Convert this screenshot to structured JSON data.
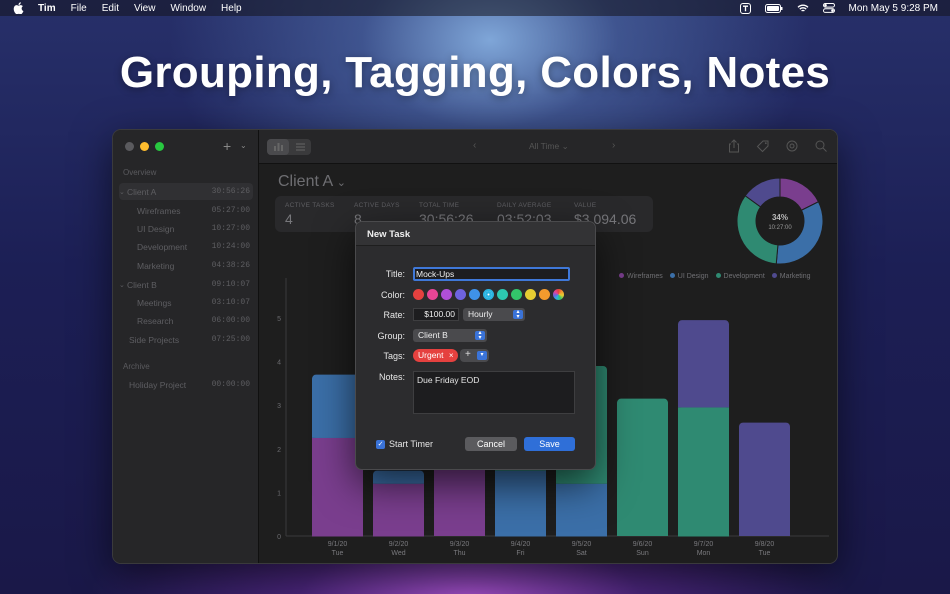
{
  "menubar": {
    "items": [
      "Tim",
      "File",
      "Edit",
      "View",
      "Window",
      "Help"
    ],
    "clock": "Mon May 5  9:28 PM"
  },
  "headline": "Grouping, Tagging, Colors, Notes",
  "sidebar": {
    "overview_label": "Overview",
    "archive_label": "Archive",
    "rows": [
      {
        "label": "Client A",
        "time": "30:56:26"
      },
      {
        "label": "Wireframes",
        "time": "05:27:00"
      },
      {
        "label": "UI Design",
        "time": "10:27:00"
      },
      {
        "label": "Development",
        "time": "10:24:00"
      },
      {
        "label": "Marketing",
        "time": "04:38:26"
      },
      {
        "label": "Client B",
        "time": "09:10:07"
      },
      {
        "label": "Meetings",
        "time": "03:10:07"
      },
      {
        "label": "Research",
        "time": "06:00:00"
      },
      {
        "label": "Side Projects",
        "time": "07:25:00"
      },
      {
        "label": "Holiday Project",
        "time": "00:00:00"
      }
    ]
  },
  "toolbar": {
    "range_label": "All Time",
    "range_chevron": "⌄",
    "prev": "‹",
    "next": "›"
  },
  "main": {
    "client_title": "Client A",
    "chevron": "⌄",
    "stats": [
      {
        "label": "ACTIVE TASKS",
        "value": "4"
      },
      {
        "label": "ACTIVE DAYS",
        "value": "8"
      },
      {
        "label": "TOTAL TIME",
        "value": "30:56:26"
      },
      {
        "label": "DAILY AVERAGE",
        "value": "03:52:03"
      },
      {
        "label": "VALUE",
        "value": "$3,094.06"
      }
    ],
    "legend": [
      {
        "name": "Wireframes",
        "color": "#7a3e8e"
      },
      {
        "name": "UI Design",
        "color": "#3b6fa8"
      },
      {
        "name": "Development",
        "color": "#2f8a72"
      },
      {
        "name": "Marketing",
        "color": "#4f4a8e"
      }
    ],
    "donut": {
      "percent": "34%",
      "time": "10:27:00",
      "slices": [
        {
          "name": "Wireframes",
          "value": 5.45,
          "color": "#7a3e8e"
        },
        {
          "name": "UI Design",
          "value": 10.45,
          "color": "#3b6fa8"
        },
        {
          "name": "Development",
          "value": 10.4,
          "color": "#2f8a72"
        },
        {
          "name": "Marketing",
          "value": 4.64,
          "color": "#4f4a8e"
        }
      ]
    }
  },
  "chart_data": {
    "type": "bar",
    "stacked": true,
    "categories": [
      "9/1/20",
      "9/2/20",
      "9/3/20",
      "9/4/20",
      "9/5/20",
      "9/6/20",
      "9/7/20",
      "9/8/20"
    ],
    "sub_labels": [
      "Tue",
      "Wed",
      "Thu",
      "Fri",
      "Sat",
      "Sun",
      "Mon",
      "Tue"
    ],
    "ylim": [
      0,
      5
    ],
    "yticks": [
      "0",
      "1",
      "2",
      "3",
      "4",
      "5"
    ],
    "series": [
      {
        "name": "Wireframes",
        "color": "#7a3e8e",
        "values": [
          2.25,
          1.2,
          1.7,
          0,
          0,
          0,
          0,
          0
        ]
      },
      {
        "name": "UI Design",
        "color": "#3b6fa8",
        "values": [
          1.45,
          0.3,
          0,
          1.5,
          1.2,
          0,
          0,
          0
        ]
      },
      {
        "name": "Development",
        "color": "#2f8a72",
        "values": [
          0,
          0,
          0,
          0.3,
          2.7,
          3.15,
          2.95,
          0
        ]
      },
      {
        "name": "Marketing",
        "color": "#4f4a8e",
        "values": [
          0,
          0,
          0,
          0,
          0,
          0,
          2.0,
          2.6
        ]
      }
    ],
    "grid": false
  },
  "modal": {
    "title": "New Task",
    "title_label": "Title:",
    "title_value": "Mock-Ups",
    "color_label": "Color:",
    "swatches": [
      "#e5413f",
      "#e84595",
      "#b04fd6",
      "#6e63e0",
      "#3f92e8",
      "#2ab4e0",
      "#2dc7b0",
      "#33c46a",
      "#e6cd32",
      "#f29a2d"
    ],
    "selected_color": "#2ab4e0",
    "rate_label": "Rate:",
    "rate_value": "$100.00",
    "rate_unit": "Hourly",
    "group_label": "Group:",
    "group_value": "Client B",
    "tags_label": "Tags:",
    "tag": "Urgent",
    "tag_remove": "×",
    "tag_add": "+",
    "notes_label": "Notes:",
    "notes_value": "Due Friday EOD",
    "start_timer_label": "Start Timer",
    "start_timer_checked": true,
    "cancel_label": "Cancel",
    "save_label": "Save"
  }
}
